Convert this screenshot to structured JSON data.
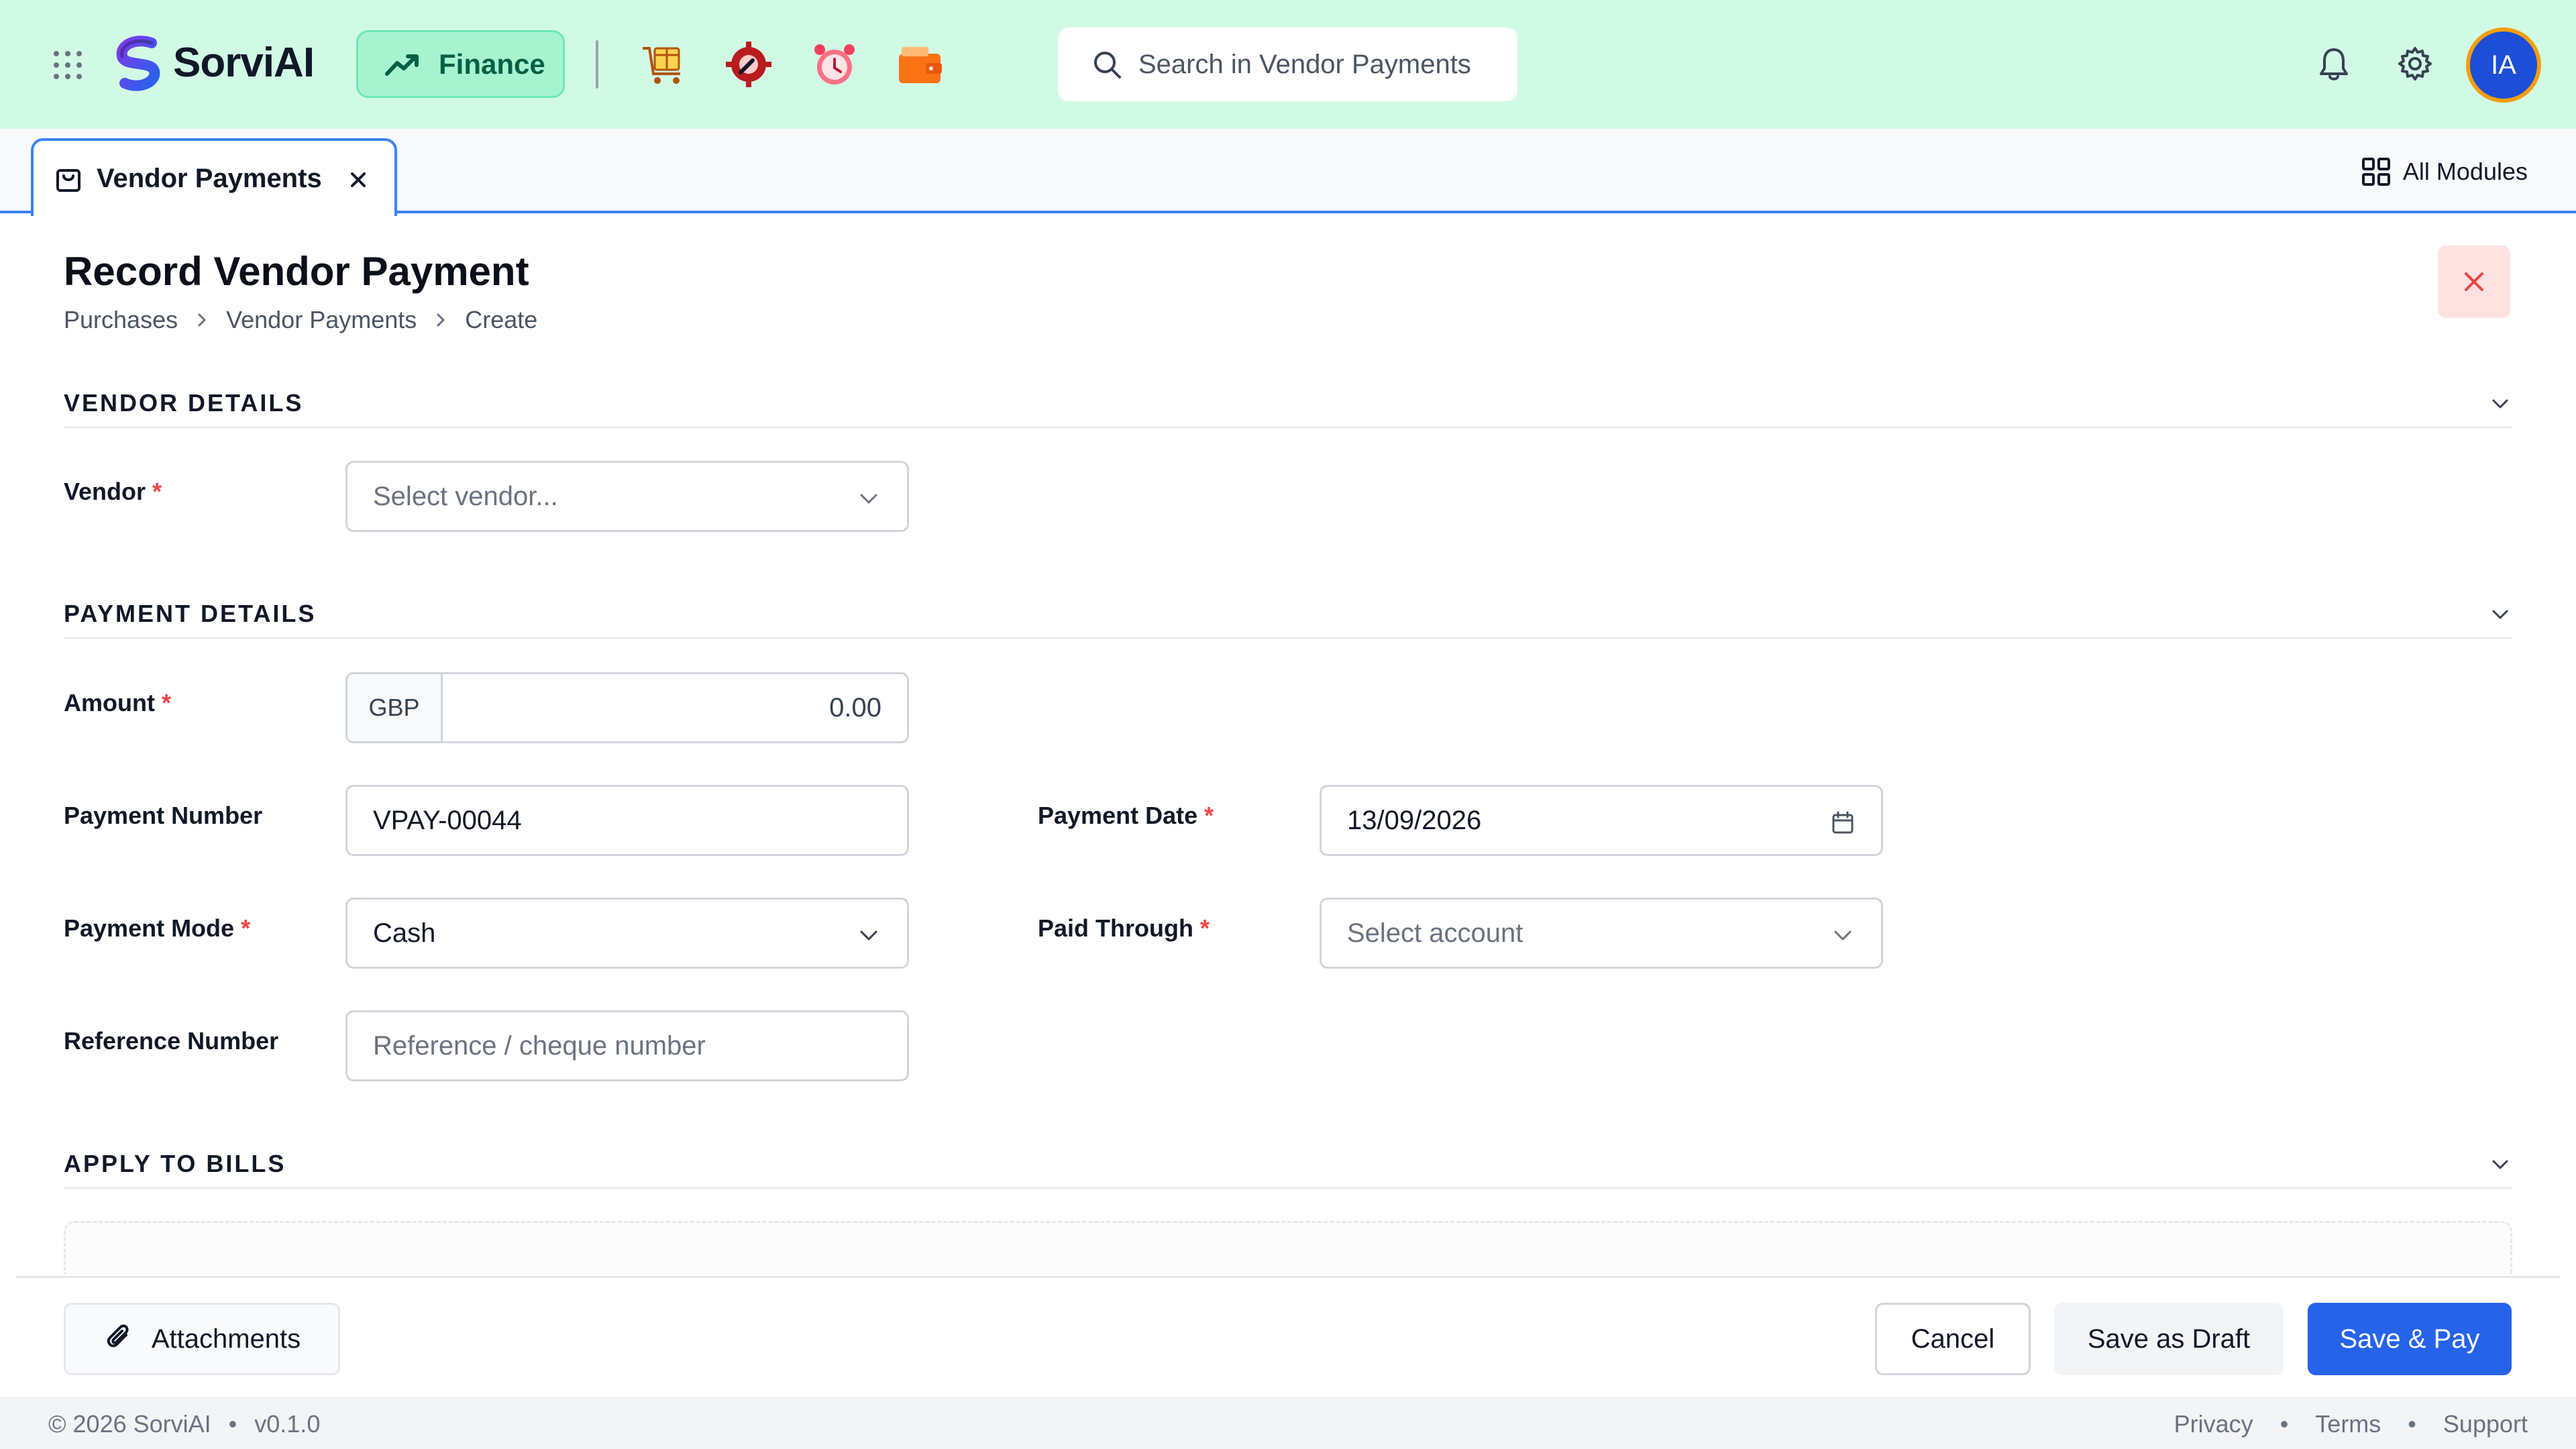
{
  "app": {
    "name": "SorviAI",
    "module": "Finance",
    "search_placeholder": "Search in Vendor Payments",
    "user_initials": "IA"
  },
  "tabs": [
    {
      "label": "Vendor Payments",
      "active": true
    }
  ],
  "all_modules_label": "All Modules",
  "page": {
    "title": "Record Vendor Payment",
    "breadcrumb": [
      "Purchases",
      "Vendor Payments",
      "Create"
    ]
  },
  "sections": {
    "vendor_details": {
      "title": "VENDOR DETAILS",
      "vendor_label": "Vendor",
      "vendor_placeholder": "Select vendor..."
    },
    "payment_details": {
      "title": "PAYMENT DETAILS",
      "amount_label": "Amount",
      "currency": "GBP",
      "amount_value": "0.00",
      "payment_number_label": "Payment Number",
      "payment_number_value": "VPAY-00044",
      "payment_date_label": "Payment Date",
      "payment_date_value": "13/09/2026",
      "payment_mode_label": "Payment Mode",
      "payment_mode_value": "Cash",
      "paid_through_label": "Paid Through",
      "paid_through_placeholder": "Select account",
      "reference_label": "Reference Number",
      "reference_placeholder": "Reference / cheque number"
    },
    "apply_to_bills": {
      "title": "APPLY TO BILLS"
    }
  },
  "actions": {
    "attachments": "Attachments",
    "cancel": "Cancel",
    "save_draft": "Save as Draft",
    "save_pay": "Save & Pay"
  },
  "footer": {
    "copyright": "© 2026 SorviAI",
    "version": "v0.1.0",
    "links": [
      "Privacy",
      "Terms",
      "Support"
    ]
  },
  "colors": {
    "topbar_bg": "#d1fae5",
    "accent_primary": "#2563eb",
    "finance_pill": "#a7f3d0",
    "required_marker": "#ef4444",
    "avatar_ring": "#f59e0b"
  },
  "icons": {
    "app_grid": "grid-dots-icon",
    "logo": "sorviai-logo-icon",
    "finance": "trending-up-icon",
    "modules": [
      "inventory-box-icon",
      "settings-wrench-icon",
      "alarm-clock-icon",
      "wallet-icon"
    ],
    "search": "search-icon",
    "notifications": "bell-icon",
    "settings": "gear-icon",
    "tab": "shopping-bag-icon",
    "all_modules": "grid-squares-icon",
    "close": "close-icon",
    "chevron": "chevron-down-icon",
    "calendar": "calendar-icon",
    "attach": "paperclip-icon"
  }
}
